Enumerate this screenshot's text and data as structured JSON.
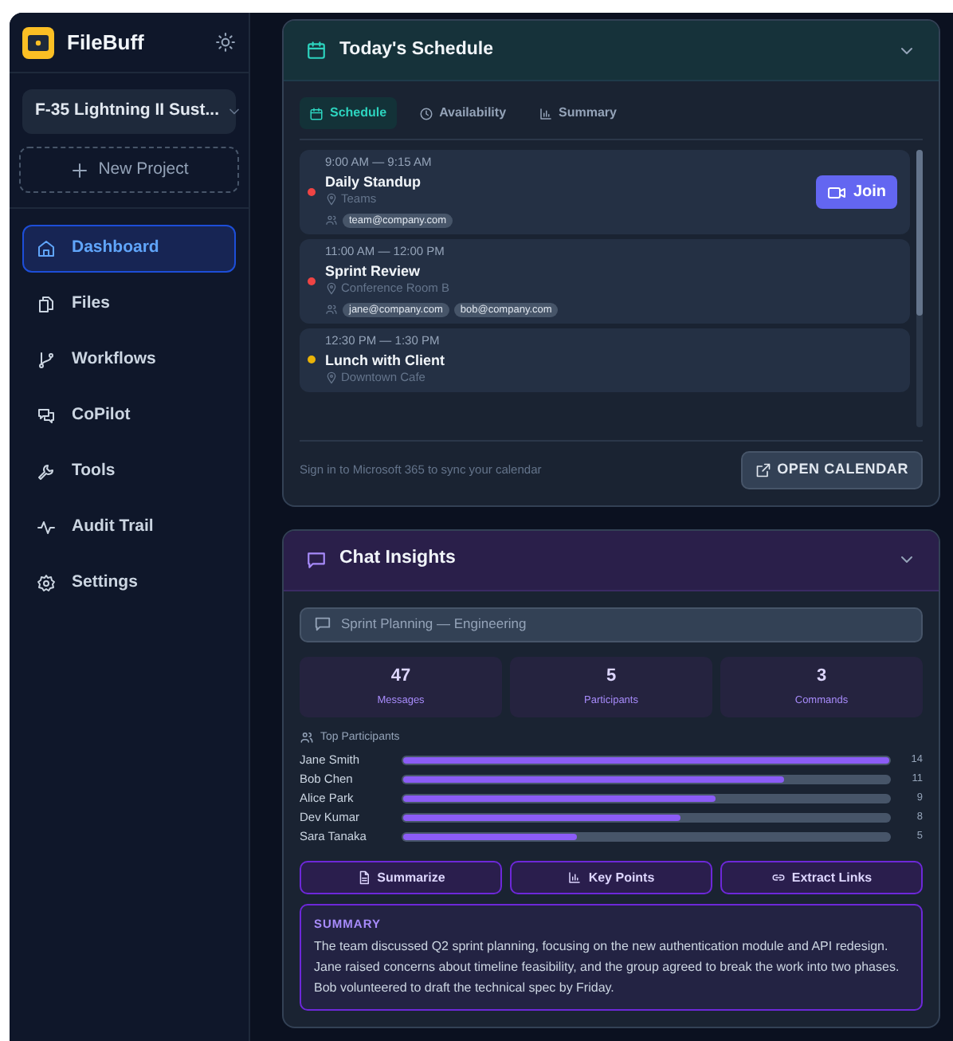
{
  "sidebar": {
    "app_name": "FileBuff",
    "project": "F-35 Lightning II Sust...",
    "new_project": "New Project",
    "items": [
      {
        "label": "Dashboard",
        "selected": true
      },
      {
        "label": "Files",
        "selected": false
      },
      {
        "label": "Workflows",
        "selected": false
      },
      {
        "label": "CoPilot",
        "selected": false
      },
      {
        "label": "Tools",
        "selected": false
      },
      {
        "label": "Audit Trail",
        "selected": false
      },
      {
        "label": "Settings",
        "selected": false
      }
    ]
  },
  "schedule": {
    "title": "Today's Schedule",
    "expanded": true,
    "tabs": [
      {
        "label": "Schedule",
        "selected": true
      },
      {
        "label": "Availability",
        "selected": false
      },
      {
        "label": "Summary",
        "selected": false
      }
    ],
    "events": [
      {
        "time": "9:00 AM — 9:15 AM",
        "title": "Daily Standup",
        "location": "Teams",
        "attendees": [
          "team@company.com"
        ],
        "color": "#ef4444",
        "join": "Join"
      },
      {
        "time": "11:00 AM — 12:00 PM",
        "title": "Sprint Review",
        "location": "Conference Room B",
        "attendees": [
          "jane@company.com",
          "bob@company.com"
        ],
        "color": "#ef4444"
      },
      {
        "time": "12:30 PM — 1:30 PM",
        "title": "Lunch with Client",
        "location": "Downtown Cafe",
        "color": "#eab308"
      }
    ],
    "footer_note": "Sign in to Microsoft 365 to sync your calendar",
    "open_button": "OPEN CALENDAR"
  },
  "chat": {
    "title": "Chat Insights",
    "expanded": true,
    "channel": "Sprint Planning — Engineering",
    "stats": [
      {
        "value": "47",
        "label": "Messages"
      },
      {
        "value": "5",
        "label": "Participants"
      },
      {
        "value": "3",
        "label": "Commands"
      }
    ],
    "participants_heading": "Top Participants",
    "participants": [
      {
        "name": "Jane Smith",
        "level": 1,
        "count": "14"
      },
      {
        "name": "Bob Chen",
        "level": 0.785,
        "count": "11"
      },
      {
        "name": "Alice Park",
        "level": 0.643,
        "count": "9"
      },
      {
        "name": "Dev Kumar",
        "level": 0.571,
        "count": "8"
      },
      {
        "name": "Sara Tanaka",
        "level": 0.357,
        "count": "5"
      }
    ],
    "actions": [
      {
        "label": "Summarize"
      },
      {
        "label": "Key Points"
      },
      {
        "label": "Extract Links"
      }
    ],
    "summary_heading": "SUMMARY",
    "summary": "The team discussed Q2 sprint planning, focusing on the new authentication module and API redesign. Jane raised concerns about timeline feasibility, and the group agreed to break the work into two phases. Bob volunteered to draft the technical spec by Friday."
  }
}
